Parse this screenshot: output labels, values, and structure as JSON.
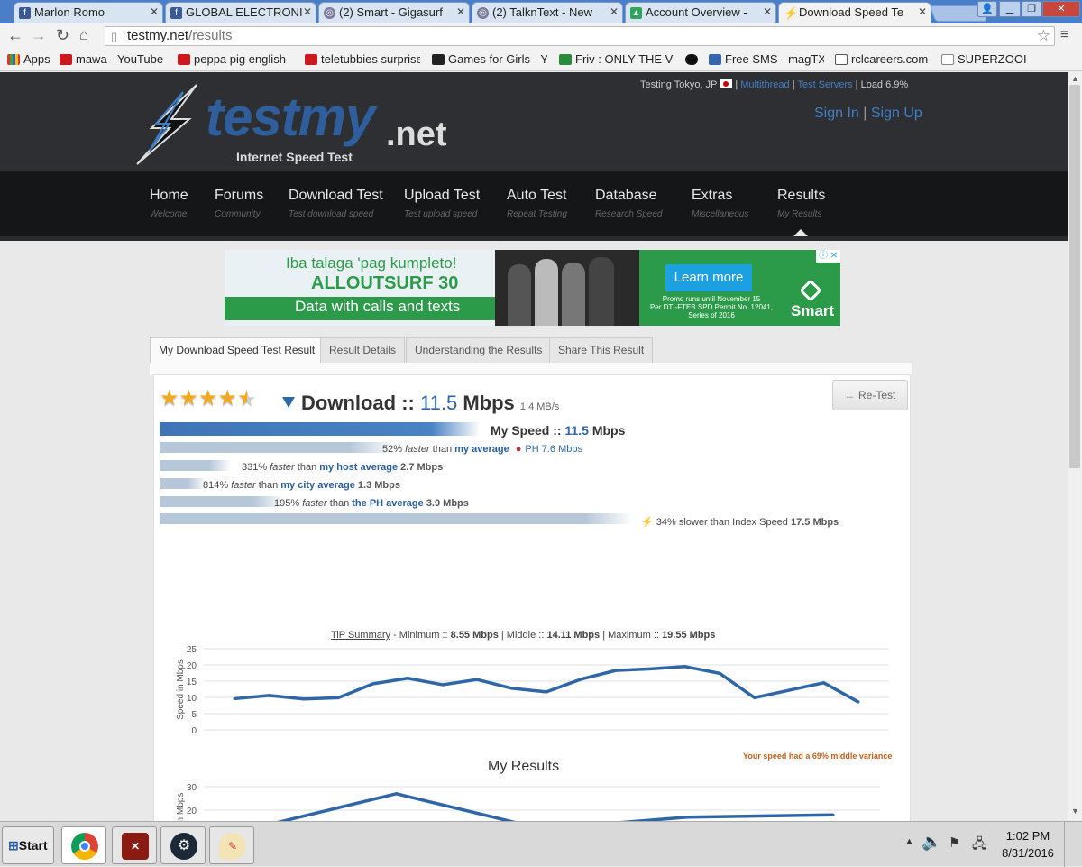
{
  "browser": {
    "tabs": [
      {
        "title": "Marlon Romo",
        "icon": "facebook-icon"
      },
      {
        "title": "GLOBAL ELECTRONI",
        "icon": "facebook-icon"
      },
      {
        "title": "(2) Smart - Gigasurf",
        "icon": "globe-icon"
      },
      {
        "title": "(2) TalknText - New",
        "icon": "globe-icon"
      },
      {
        "title": "Account Overview -",
        "icon": "leaf-icon"
      },
      {
        "title": "Download Speed Te",
        "icon": "bolt-icon"
      }
    ],
    "url_host": "testmy.net",
    "url_path": "/results",
    "bookmarks": [
      {
        "label": "Apps"
      },
      {
        "label": "mawa - YouTube"
      },
      {
        "label": "peppa pig english"
      },
      {
        "label": "teletubbies surprise"
      },
      {
        "label": "Games for Girls - Y"
      },
      {
        "label": "Friv : ONLY THE V"
      },
      {
        "label": ""
      },
      {
        "label": "Free SMS - magTX"
      },
      {
        "label": "rclcareers.com"
      },
      {
        "label": "SUPERZOOI"
      }
    ]
  },
  "site": {
    "testing": "Testing Tokyo, JP",
    "multithread": "Multithread",
    "test_servers": "Test Servers",
    "load": "Load 6.9%",
    "sep": "|",
    "sign_in": "Sign In",
    "sign_up": "Sign Up",
    "logo_main": "testmy",
    "logo_tld": ".net",
    "logo_tagline": "Internet Speed Test",
    "nav": [
      {
        "label": "Home",
        "sub": "Welcome"
      },
      {
        "label": "Forums",
        "sub": "Community"
      },
      {
        "label": "Download Test",
        "sub": "Test download speed"
      },
      {
        "label": "Upload Test",
        "sub": "Test upload speed"
      },
      {
        "label": "Auto Test",
        "sub": "Repeat Testing"
      },
      {
        "label": "Database",
        "sub": "Research Speed"
      },
      {
        "label": "Extras",
        "sub": "Miscellaneous"
      },
      {
        "label": "Results",
        "sub": "My Results"
      }
    ]
  },
  "ad": {
    "headline": "Iba talaga 'pag kumpleto!",
    "product": "ALLOUTSURF 30",
    "sub": "Data with calls and texts",
    "cta": "Learn more",
    "fine1": "Promo runs until November 15",
    "fine2": "Per DTI-FTEB SPD Permit No. 12041,",
    "fine3": "Series of 2016",
    "brand": "Smart"
  },
  "result_tabs": [
    "My Download Speed Test Result",
    "Result Details",
    "Understanding the Results",
    "Share This Result"
  ],
  "result": {
    "rating_stars": 4.5,
    "title_label": "Download ::",
    "speed": "11.5",
    "unit": "Mbps",
    "mbs": "1.4 MB/s",
    "retest": "← Re-Test",
    "my_speed_label": "My Speed ::",
    "comparisons": [
      {
        "pct": "52%",
        "word": "faster",
        "than": "than",
        "link": "my average",
        "extra": "PH 7.6 Mbps",
        "fill": 0.45
      },
      {
        "pct": "331%",
        "word": "faster",
        "than": "than",
        "link": "my host average",
        "extra": "2.7 Mbps",
        "fill": 0.11
      },
      {
        "pct": "814%",
        "word": "faster",
        "than": "than",
        "link": "my city average",
        "extra": "1.3 Mbps",
        "fill": 0.06
      },
      {
        "pct": "195%",
        "word": "faster",
        "than": "than",
        "link": "the PH average",
        "extra": "3.9 Mbps",
        "fill": 0.22
      }
    ],
    "index": {
      "text": "34% slower than Index Speed",
      "value": "17.5 Mbps"
    }
  },
  "tip_summary": {
    "label": "TiP Summary",
    "min_label": "- Minimum ::",
    "min": "8.55 Mbps",
    "mid_label": "| Middle ::",
    "mid": "14.11 Mbps",
    "max_label": "| Maximum ::",
    "max": "19.55 Mbps"
  },
  "variance": "Your speed had a 69% middle variance",
  "my_results_title": "My Results",
  "chart_data": [
    {
      "type": "line",
      "title": "",
      "xlabel": "",
      "ylabel": "Speed in Mbps",
      "ylim": [
        0,
        25
      ],
      "yticks": [
        0,
        5,
        10,
        15,
        20,
        25
      ],
      "grid": true,
      "color": "#2e66a8",
      "values": [
        9.6,
        10.6,
        9.5,
        9.9,
        14.2,
        15.9,
        13.9,
        15.5,
        12.8,
        11.7,
        15.6,
        18.3,
        18.8,
        19.5,
        17.4,
        9.9,
        12.2,
        14.5,
        8.6
      ]
    },
    {
      "type": "line",
      "title": "My Results",
      "xlabel": "",
      "ylabel": "Speed in Mbps",
      "ylim": [
        0,
        30
      ],
      "yticks": [
        20,
        30
      ],
      "grid": true,
      "color": "#2e66a8",
      "values": [
        12,
        27,
        12,
        17,
        18
      ]
    }
  ],
  "taskbar": {
    "start": "Start",
    "time": "1:02 PM",
    "date": "8/31/2016",
    "apps": [
      "chrome-icon",
      "dota-icon",
      "steam-icon",
      "paint-icon"
    ]
  },
  "colors": {
    "accent": "#2e66a8",
    "header": "#2d2f33",
    "nav": "#151618",
    "link": "#2a5d9b"
  }
}
